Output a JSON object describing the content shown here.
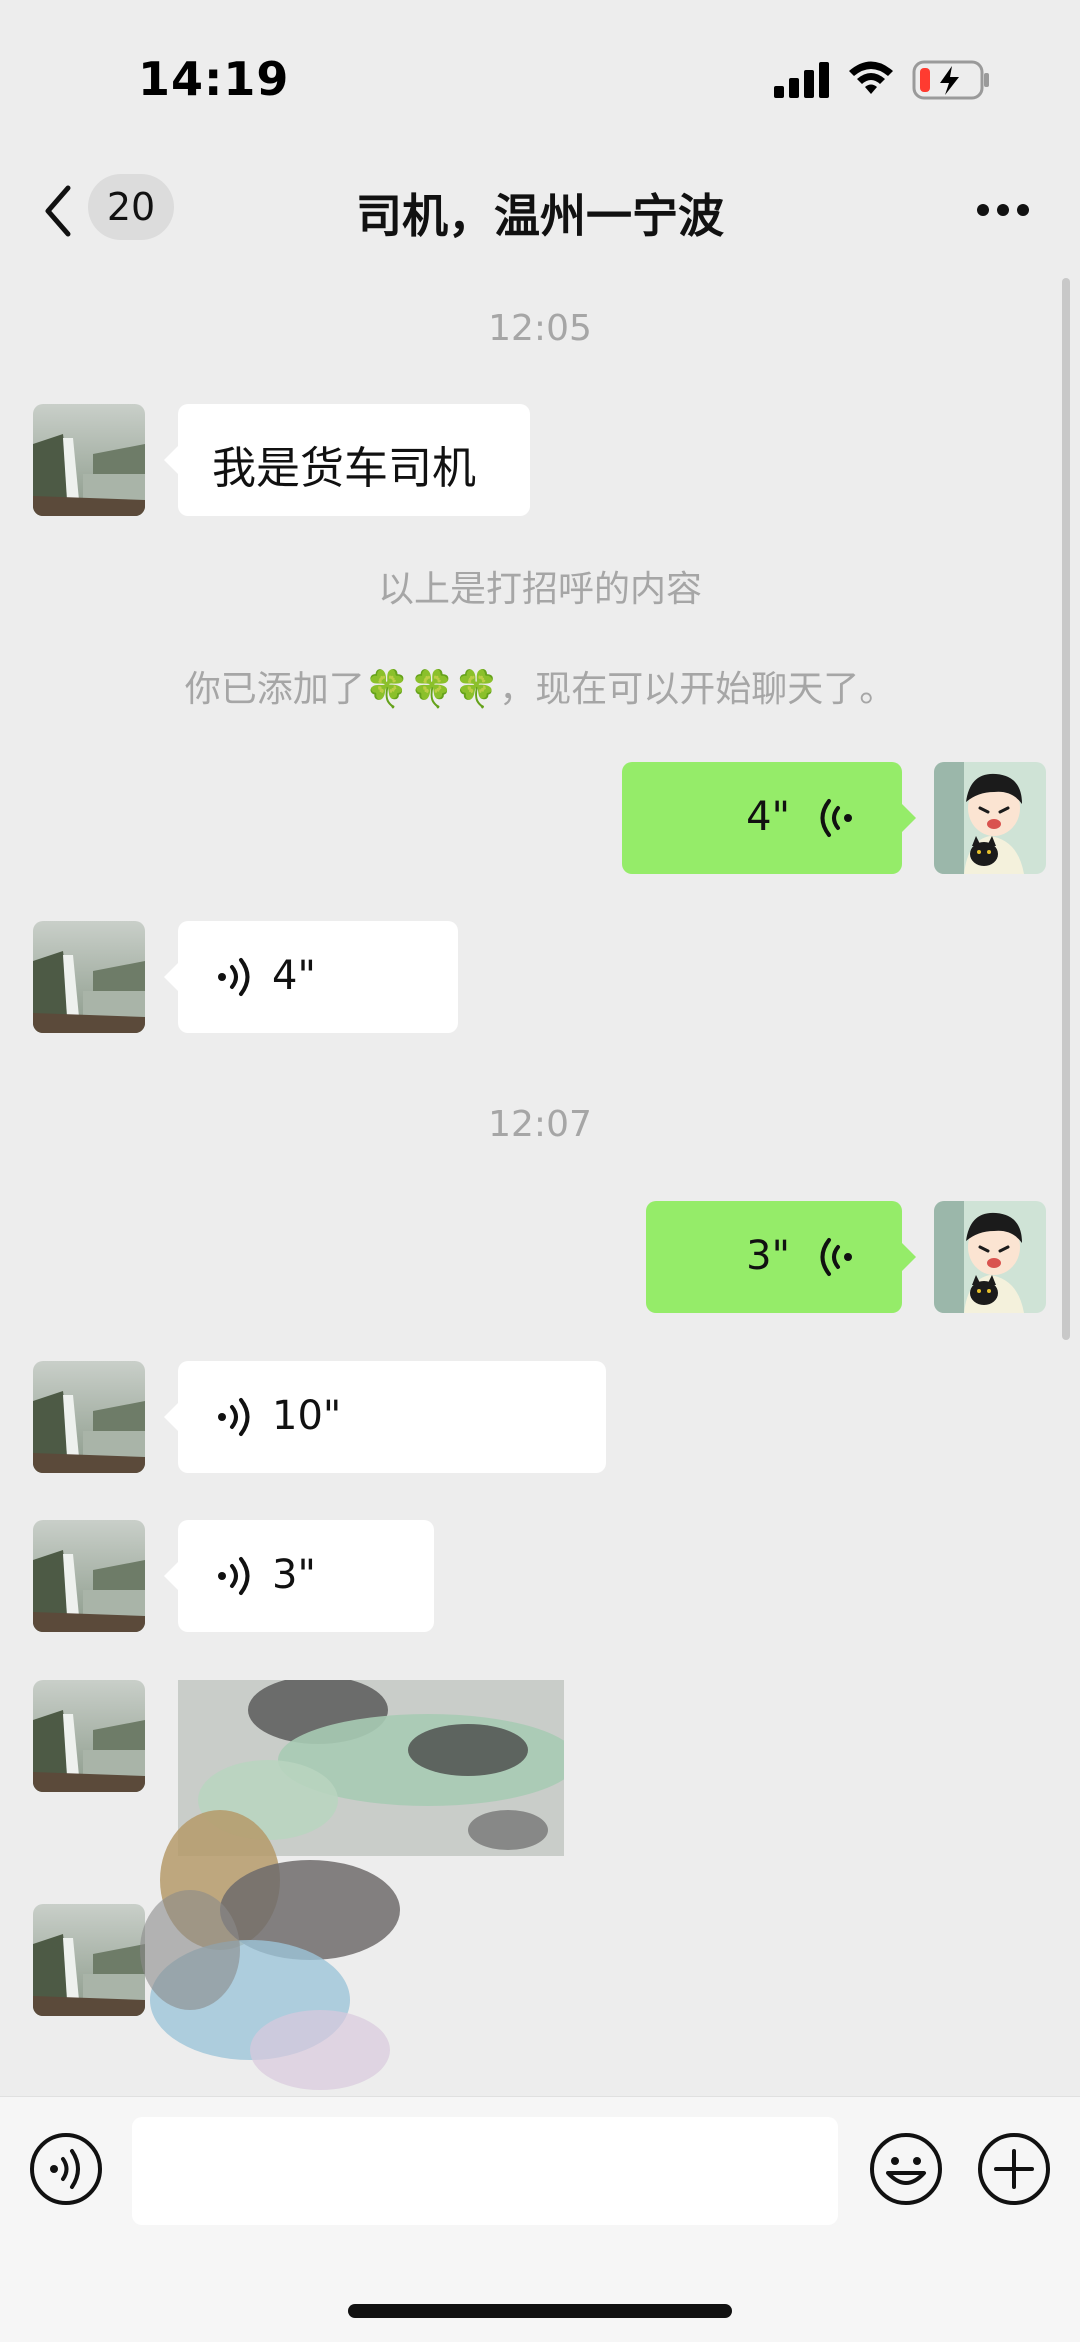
{
  "status_bar": {
    "time": "14:19",
    "icons": [
      "signal-icon",
      "wifi-icon",
      "battery-charging-icon"
    ]
  },
  "nav": {
    "back_icon": "chevron-left-icon",
    "unread_count": "20",
    "title": "司机，温州一宁波",
    "more_icon": "more-horizontal-icon"
  },
  "messages": {
    "time_1": "12:05",
    "greeting_text": "我是货车司机",
    "system_greeting_note": "以上是打招呼的内容",
    "system_added_note": "你已添加了🍀🍀🍀，现在可以开始聊天了。",
    "voice_out_1": "4\"",
    "voice_in_1": "4\"",
    "time_2": "12:07",
    "voice_out_2": "3\"",
    "voice_in_2": "10\"",
    "voice_in_3": "3\""
  },
  "input_bar": {
    "voice_toggle_icon": "voice-mode-icon",
    "input_value": "",
    "emoji_icon": "emoji-icon",
    "plus_icon": "plus-circle-icon"
  },
  "colors": {
    "background": "#ededed",
    "outgoing_bubble": "#95ec69",
    "incoming_bubble": "#ffffff",
    "muted_text": "#a6a6a6"
  }
}
